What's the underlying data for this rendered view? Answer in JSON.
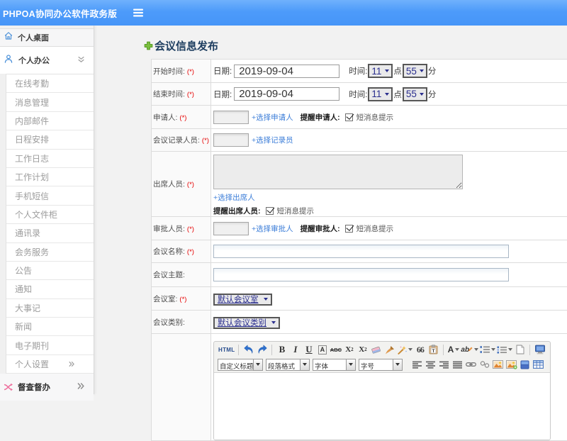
{
  "header": {
    "title": "PHPOA协同办公软件政务版"
  },
  "sidebar": {
    "desktop_label": "个人桌面",
    "office_label": "个人办公",
    "submenu": [
      "在线考勤",
      "消息管理",
      "内部邮件",
      "日程安排",
      "工作日志",
      "工作计划",
      "手机短信",
      "个人文件柜",
      "通讯录",
      "会务服务",
      "公告",
      "通知",
      "大事记",
      "新闻",
      "电子期刊",
      "个人设置"
    ],
    "supervision_label": "督查督办"
  },
  "main": {
    "page_title": "会议信息发布"
  },
  "form": {
    "required_mark": "(*)",
    "start_time": {
      "label": "开始时间:",
      "date_label": "日期:",
      "date_value": "2019-09-04",
      "time_label": "时间:",
      "hour": "11",
      "hour_suffix": "点",
      "minute": "55",
      "minute_suffix": "分"
    },
    "end_time": {
      "label": "结束时间:",
      "date_label": "日期:",
      "date_value": "2019-09-04",
      "time_label": "时间:",
      "hour": "11",
      "hour_suffix": "点",
      "minute": "55",
      "minute_suffix": "分"
    },
    "applicant": {
      "label": "申请人:",
      "link": "+选择申请人",
      "remind_label": "提醒申请人:",
      "sms_label": "短消息提示",
      "checked": true
    },
    "recorder": {
      "label": "会议记录人员:",
      "link": "+选择记录员"
    },
    "attendees": {
      "label": "出席人员:",
      "link": "+选择出席人",
      "remind_label": "提醒出席人员:",
      "sms_label": "短消息提示",
      "checked": true
    },
    "approver": {
      "label": "审批人员:",
      "link": "+选择审批人",
      "remind_label": "提醒审批人:",
      "sms_label": "短消息提示",
      "checked": true
    },
    "meeting_name": {
      "label": "会议名称:"
    },
    "meeting_subject": {
      "label": "会议主题:"
    },
    "meeting_room": {
      "label": "会议室:",
      "value": "默认会议室"
    },
    "meeting_type": {
      "label": "会议类别:",
      "value": "默认会议类别"
    }
  },
  "editor": {
    "source_label": "HTML",
    "bold_label": "B",
    "italic_label": "I",
    "underline_label": "U",
    "font_style_label": "A",
    "strike_label": "ABC",
    "sup_label": "X",
    "sup_digit": "2",
    "sub_label": "X",
    "sub_digit": "2",
    "quote_label": "66",
    "font_color_label": "A",
    "highlight_label": "ab",
    "combos": {
      "heading": "自定义标题",
      "paragraph": "段落格式",
      "font": "字体",
      "size": "字号"
    },
    "toolbar_row1_icons": [
      "source",
      "undo",
      "redo",
      "bold",
      "italic",
      "underline",
      "font-style",
      "strikethrough",
      "superscript",
      "subscript",
      "eraser",
      "format-brush",
      "magic-wand",
      "blockquote",
      "paste-as-text",
      "font-color",
      "highlight",
      "ordered-list",
      "unordered-list",
      "new-page",
      "fullscreen"
    ],
    "toolbar_row2_icons": [
      "heading-combo",
      "paragraph-combo",
      "font-combo",
      "size-combo",
      "align-left",
      "align-center",
      "align-right",
      "align-justify",
      "link",
      "unlink",
      "image",
      "image-upload",
      "media",
      "table"
    ]
  },
  "colors": {
    "header_blue": "#4d9bfa",
    "sidebar_icon_blue": "#4a90d9",
    "link_blue": "#3b7dd8",
    "required_red": "#e60000",
    "select_navy": "#2b2f8e",
    "supervision_pink": "#ee6f9d",
    "plus_green": "#7cbf3f",
    "title_navy": "#1d3d5f"
  }
}
